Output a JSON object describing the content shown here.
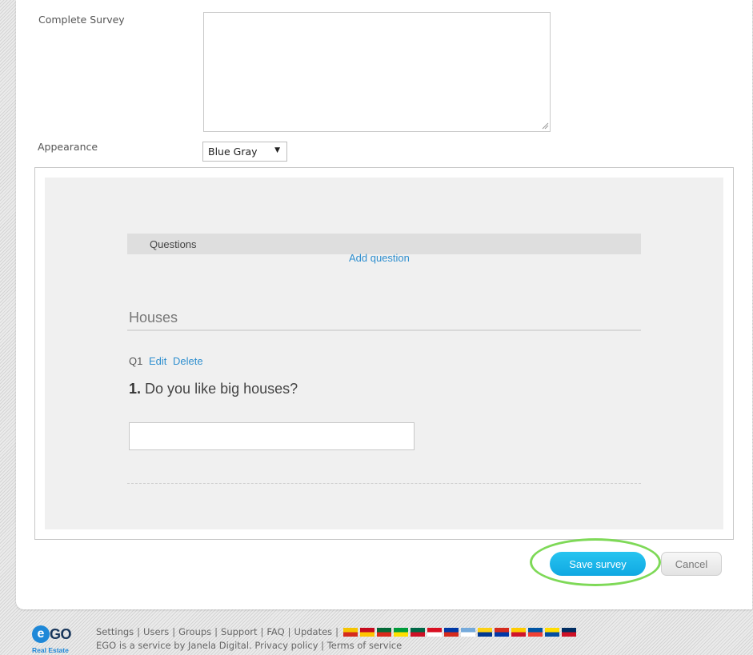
{
  "form": {
    "complete_survey_label": "Complete Survey",
    "complete_survey_value": "",
    "appearance_label": "Appearance",
    "appearance_selected": "Blue Gray"
  },
  "preview": {
    "questions_header": "Questions",
    "add_question_link": "Add question",
    "section_title": "Houses",
    "question": {
      "id_label": "Q1",
      "edit_link": "Edit",
      "delete_link": "Delete",
      "number": "1.",
      "text": "Do you like big houses?",
      "answer_value": ""
    }
  },
  "actions": {
    "save_label": "Save survey",
    "cancel_label": "Cancel"
  },
  "footer": {
    "logo_text": "GO",
    "logo_letter": "e",
    "logo_subtitle": "Real Estate",
    "links": [
      "Settings",
      "Users",
      "Groups",
      "Support",
      "FAQ",
      "Updates"
    ],
    "service_text": "EGO is a service by Janela Digital.",
    "privacy_link": "Privacy policy",
    "terms_link": "Terms of service",
    "flags": [
      {
        "name": "flag-catalonia-icon",
        "colors": [
          "#f5c400",
          "#d52b1e"
        ]
      },
      {
        "name": "flag-spain-icon",
        "colors": [
          "#c60b1e",
          "#ffc400"
        ]
      },
      {
        "name": "flag-portugal-icon",
        "colors": [
          "#046a38",
          "#da291c"
        ]
      },
      {
        "name": "flag-brazil-icon",
        "colors": [
          "#009c3b",
          "#ffdf00"
        ]
      },
      {
        "name": "flag-mexico-icon",
        "colors": [
          "#006847",
          "#ce1126"
        ]
      },
      {
        "name": "flag-peru-icon",
        "colors": [
          "#d91023",
          "#ffffff"
        ]
      },
      {
        "name": "flag-chile-icon",
        "colors": [
          "#0039a6",
          "#d52b1e"
        ]
      },
      {
        "name": "flag-argentina-icon",
        "colors": [
          "#75aadb",
          "#ffffff"
        ]
      },
      {
        "name": "flag-colombia-icon",
        "colors": [
          "#fcd116",
          "#003893"
        ]
      },
      {
        "name": "flag-paraguay-icon",
        "colors": [
          "#d52b1e",
          "#0038a8"
        ]
      },
      {
        "name": "flag-venezuela-icon",
        "colors": [
          "#ffcc00",
          "#cf142b"
        ]
      },
      {
        "name": "flag-france-icon",
        "colors": [
          "#0055a4",
          "#ef4135"
        ]
      },
      {
        "name": "flag-ecuador-icon",
        "colors": [
          "#ffdd00",
          "#034ea2"
        ]
      },
      {
        "name": "flag-dominican-icon",
        "colors": [
          "#002d62",
          "#ce1126"
        ]
      }
    ]
  },
  "colors": {
    "accent": "#1aafe6",
    "link": "#2f8fcf",
    "highlight": "#7ed957"
  }
}
